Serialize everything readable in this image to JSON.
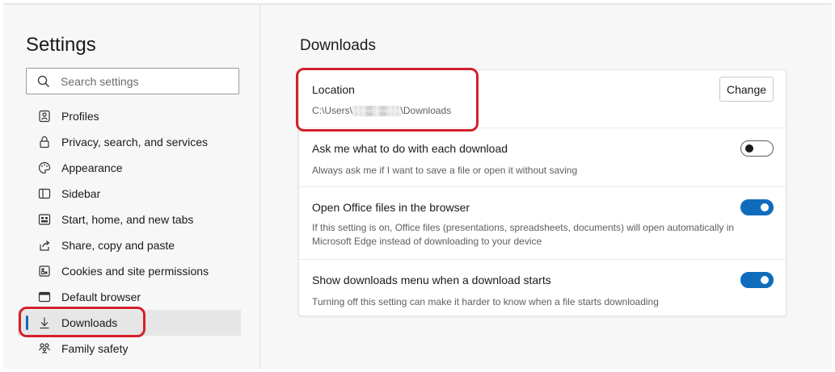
{
  "sidebar": {
    "title": "Settings",
    "search": {
      "placeholder": "Search settings",
      "icon": "search-icon"
    },
    "items": [
      {
        "label": "Profiles",
        "icon": "profiles-icon"
      },
      {
        "label": "Privacy, search, and services",
        "icon": "lock-icon"
      },
      {
        "label": "Appearance",
        "icon": "appearance-icon"
      },
      {
        "label": "Sidebar",
        "icon": "sidebar-icon"
      },
      {
        "label": "Start, home, and new tabs",
        "icon": "home-icon"
      },
      {
        "label": "Share, copy and paste",
        "icon": "share-icon"
      },
      {
        "label": "Cookies and site permissions",
        "icon": "cookies-icon"
      },
      {
        "label": "Default browser",
        "icon": "browser-icon"
      },
      {
        "label": "Downloads",
        "icon": "download-icon",
        "active": true
      },
      {
        "label": "Family safety",
        "icon": "family-icon"
      }
    ]
  },
  "main": {
    "title": "Downloads",
    "location": {
      "title": "Location",
      "path": "C:\\Users\\░░▒░▒░░\\Downloads",
      "change_label": "Change"
    },
    "ask": {
      "title": "Ask me what to do with each download",
      "desc": "Always ask me if I want to save a file or open it without saving",
      "enabled": false
    },
    "office": {
      "title": "Open Office files in the browser",
      "desc": "If this setting is on, Office files (presentations, spreadsheets, documents) will open automatically in Microsoft Edge instead of downloading to your device",
      "enabled": true
    },
    "menu": {
      "title": "Show downloads menu when a download starts",
      "desc": "Turning off this setting can make it harder to know when a file starts downloading",
      "enabled": true
    }
  },
  "colors": {
    "accent": "#0f6cbd",
    "annotation_red": "#d4202a",
    "background": "#f7f7f7",
    "active_item_bg": "#e6e6e6"
  }
}
